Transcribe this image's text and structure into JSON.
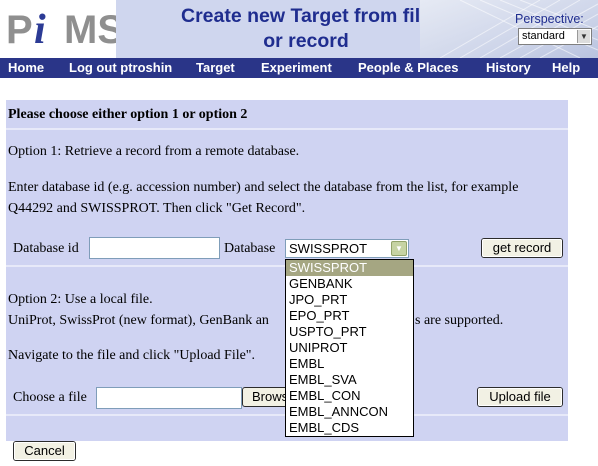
{
  "header": {
    "logo_text": "PiMS",
    "title_line1": "Create new Target from file",
    "title_line2": "or record",
    "perspective_label": "Perspective:",
    "perspective_value": "standard"
  },
  "nav": {
    "items": [
      "Home",
      "Log out ptroshin",
      "Target",
      "Experiment",
      "People & Places",
      "History",
      "Help"
    ]
  },
  "form": {
    "heading": "Please choose either option 1 or option 2",
    "option1": "Option 1: Retrieve a record from a remote database.",
    "instructions_line1": "Enter database id (e.g. accession number) and select the database from the list, for example",
    "instructions_line2": "Q44292 and SWISSPROT. Then click \"Get Record\".",
    "database_id_label": "Database id",
    "database_id_value": "",
    "database_label": "Database",
    "database_selected": "SWISSPROT",
    "get_record_button": "get record",
    "option2": "Option 2: Use a local file.",
    "formats_prefix": "UniProt, SwissProt (new format), GenBank an",
    "formats_suffix": "s are supported.",
    "navigate_prefix": "Navigate to the file and click \"Upload File\".",
    "choose_file_label": "Choose a file",
    "file_value": "",
    "browse_button": "Brows",
    "upload_button": "Upload file",
    "cancel_button": "Cancel"
  },
  "database_options": [
    "SWISSPROT",
    "GENBANK",
    "JPO_PRT",
    "EPO_PRT",
    "USPTO_PRT",
    "UNIPROT",
    "EMBL",
    "EMBL_SVA",
    "EMBL_CON",
    "EMBL_ANNCON",
    "EMBL_CDS"
  ]
}
